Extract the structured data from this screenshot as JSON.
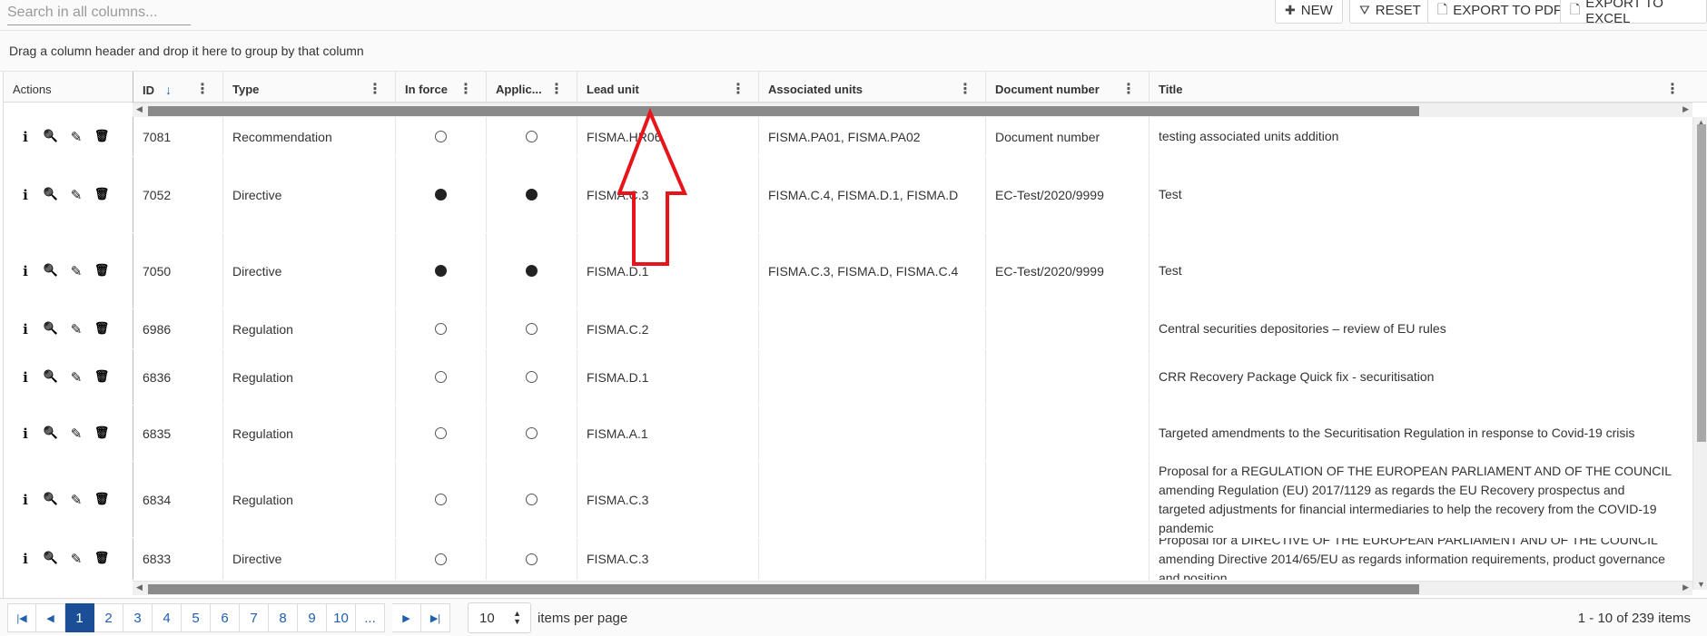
{
  "search": {
    "placeholder": "Search in all columns..."
  },
  "toolbar": {
    "new_label": "NEW",
    "reset_label": "RESET",
    "export_pdf_label": "EXPORT TO PDF",
    "export_excel_label": "EXPORT TO EXCEL"
  },
  "group_hint": "Drag a column header and drop it here to group by that column",
  "columns": {
    "actions": "Actions",
    "id": "ID",
    "type": "Type",
    "in_force": "In force",
    "applic": "Applic...",
    "lead_unit": "Lead unit",
    "associated_units": "Associated units",
    "document_number": "Document number",
    "title": "Title"
  },
  "rows": [
    {
      "id": "7081",
      "type": "Recommendation",
      "in_force": false,
      "applic": false,
      "lead_unit": "FISMA.HR06",
      "associated_units": "FISMA.PA01, FISMA.PA02",
      "document_number": "Document number",
      "title": "testing associated units addition"
    },
    {
      "id": "7052",
      "type": "Directive",
      "in_force": true,
      "applic": true,
      "lead_unit": "FISMA.C.3",
      "associated_units": "FISMA.C.4, FISMA.D.1, FISMA.D",
      "document_number": "EC-Test/2020/9999",
      "title": "Test"
    },
    {
      "id": "7050",
      "type": "Directive",
      "in_force": true,
      "applic": true,
      "lead_unit": "FISMA.D.1",
      "associated_units": "FISMA.C.3, FISMA.D, FISMA.C.4",
      "document_number": "EC-Test/2020/9999",
      "title": "Test"
    },
    {
      "id": "6986",
      "type": "Regulation",
      "in_force": false,
      "applic": false,
      "lead_unit": "FISMA.C.2",
      "associated_units": "",
      "document_number": "",
      "title": "Central securities depositories – review of EU rules"
    },
    {
      "id": "6836",
      "type": "Regulation",
      "in_force": false,
      "applic": false,
      "lead_unit": "FISMA.D.1",
      "associated_units": "",
      "document_number": "",
      "title": "CRR Recovery Package Quick fix - securitisation"
    },
    {
      "id": "6835",
      "type": "Regulation",
      "in_force": false,
      "applic": false,
      "lead_unit": "FISMA.A.1",
      "associated_units": "",
      "document_number": "",
      "title": "Targeted amendments to the Securitisation Regulation in response to Covid-19 crisis"
    },
    {
      "id": "6834",
      "type": "Regulation",
      "in_force": false,
      "applic": false,
      "lead_unit": "FISMA.C.3",
      "associated_units": "",
      "document_number": "",
      "title": "Proposal for a REGULATION OF THE EUROPEAN PARLIAMENT AND OF THE COUNCIL amending Regulation (EU) 2017/1129 as regards the EU Recovery prospectus and targeted adjustments for financial intermediaries to help the recovery from the COVID-19 pandemic"
    },
    {
      "id": "6833",
      "type": "Directive",
      "in_force": false,
      "applic": false,
      "lead_unit": "FISMA.C.3",
      "associated_units": "",
      "document_number": "",
      "title": "Proposal for a DIRECTIVE OF THE EUROPEAN PARLIAMENT AND OF THE COUNCIL amending Directive 2014/65/EU as regards information requirements, product governance and position"
    }
  ],
  "pager": {
    "pages": [
      "1",
      "2",
      "3",
      "4",
      "5",
      "6",
      "7",
      "8",
      "9",
      "10",
      "..."
    ],
    "current_page": "1",
    "page_size": "10",
    "items_per_page_label": "items per page",
    "summary": "1 - 10 of 239 items"
  },
  "colors": {
    "accent": "#1a4e96",
    "annotation_arrow": "#e8141c"
  }
}
